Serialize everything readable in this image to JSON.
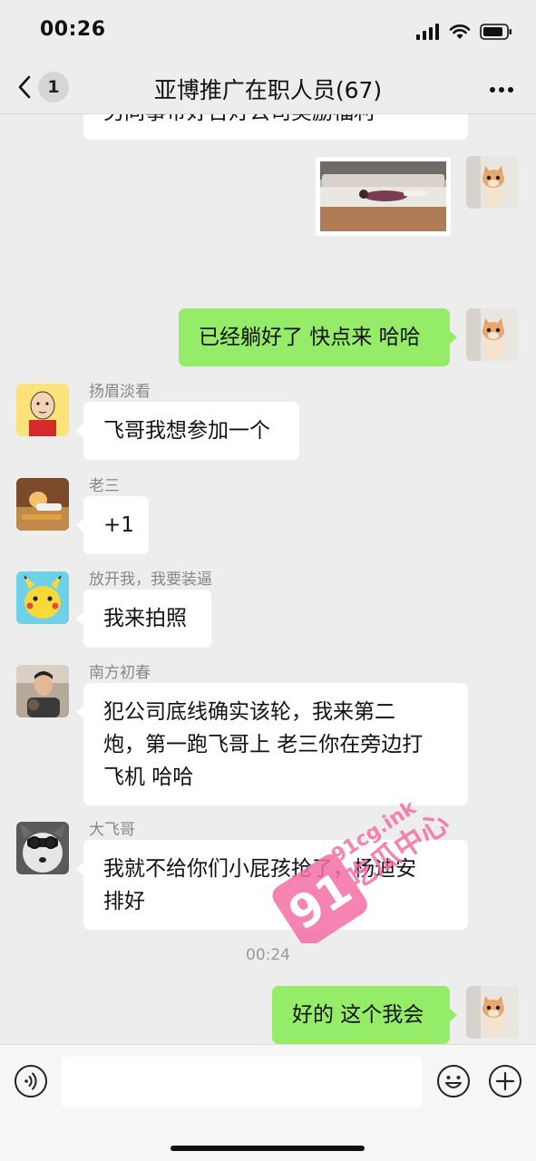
{
  "status": {
    "time": "00:26"
  },
  "nav": {
    "back_count": "1",
    "title": "亚博推广在职人员(67)"
  },
  "messages": {
    "m0": {
      "text": "另同事带好台灯公司奖励福利"
    },
    "m2": {
      "text": "已经躺好了 快点来 哈哈"
    },
    "m3": {
      "sender": "扬眉淡看",
      "text": "飞哥我想参加一个"
    },
    "m4": {
      "sender": "老三",
      "text": "+1"
    },
    "m5": {
      "sender": "放开我，我要装逼",
      "text": "我来拍照"
    },
    "m6": {
      "sender": "南方初春",
      "line1": "犯公司底线确实该轮，我来第二",
      "line2": "炮，第一跑飞哥上 老三你在旁边打",
      "line3": "飞机 哈哈"
    },
    "m7": {
      "sender": "大飞哥",
      "line1": "我就不给你们小屁孩抢了，杨迪安",
      "line2": "排好"
    },
    "time_divider": "00:24",
    "m8": {
      "text": "好的 这个我会"
    }
  },
  "watermark": {
    "number": "91",
    "domain": "91cg.ink",
    "label": "吃瓜中心"
  },
  "colors": {
    "green_bubble": "#95ec69",
    "background": "#ededed",
    "watermark_pink": "#f56fa6"
  },
  "icons": [
    "signal-icon",
    "wifi-icon",
    "battery-icon",
    "back-chevron-icon",
    "more-icon",
    "voice-icon",
    "emoji-icon",
    "plus-icon"
  ]
}
